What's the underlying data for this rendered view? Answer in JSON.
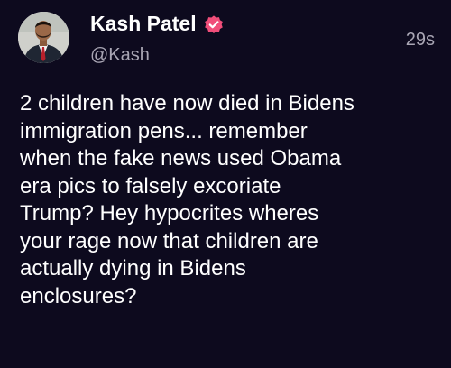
{
  "post": {
    "author": {
      "name": "Kash Patel",
      "handle": "@Kash",
      "verified_icon": "verified-badge-icon",
      "verified_color": "#f04e7a"
    },
    "timestamp": "29s",
    "body_lines": [
      "2 children have now died in Bidens",
      "immigration pens... remember",
      "when the fake news used Obama",
      "era pics to falsely excoriate",
      "Trump? Hey hypocrites wheres",
      "your rage now that children are",
      "actually dying in Bidens",
      "enclosures?"
    ]
  },
  "colors": {
    "background": "#0d0a1e",
    "primary_text": "#ffffff",
    "secondary_text": "#a9a6b4"
  }
}
